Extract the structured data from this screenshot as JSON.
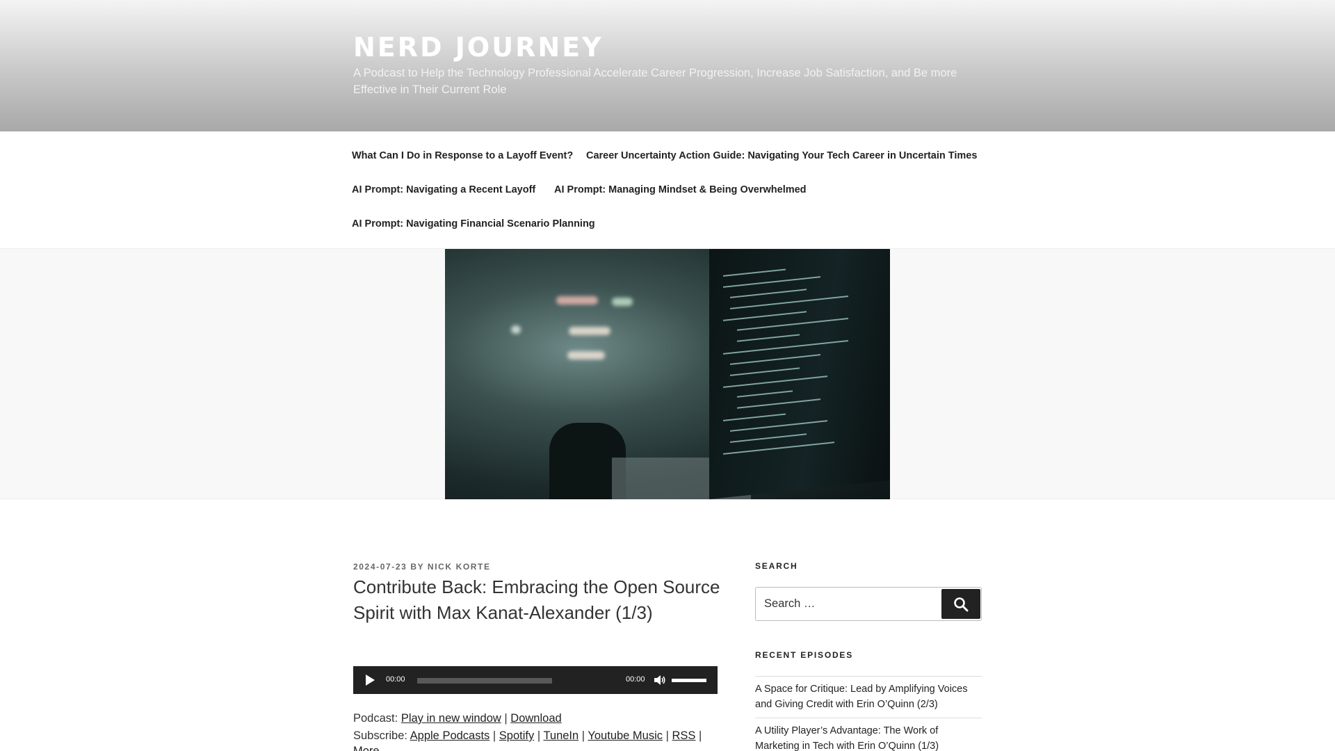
{
  "site": {
    "title": "NERD JOURNEY",
    "description": "A Podcast to Help the Technology Professional Accelerate Career Progression, Increase Job Satisfaction, and Be more Effective in Their Current Role"
  },
  "nav": {
    "items": [
      {
        "label": "What Can I Do in Response to a Layoff Event?"
      },
      {
        "label": "Career Uncertainty Action Guide: Navigating Your Tech Career in Uncertain Times"
      },
      {
        "label": "AI Prompt: Navigating a Recent Layoff"
      },
      {
        "label": "AI Prompt: Managing Mindset & Being Overwhelmed"
      },
      {
        "label": "AI Prompt: Navigating Financial Scenario Planning"
      }
    ]
  },
  "post": {
    "date": "2024-07-23",
    "by": "BY",
    "author": "NICK KORTE",
    "title": "Contribute Back: Embracing the Open Source Spirit with Max Kanat-Alexander (1/3)"
  },
  "player": {
    "current_time": "00:00",
    "duration": "00:00",
    "progress": 0,
    "volume": 1.0
  },
  "podcast": {
    "podcast_label": "Podcast:",
    "play_new_window": "Play in new window",
    "download": "Download",
    "subscribe_label": "Subscribe:",
    "apple": "Apple Podcasts",
    "spotify": "Spotify",
    "tunein": "TuneIn",
    "youtube_music": "Youtube Music",
    "rss": "RSS",
    "more": "More",
    "sep": "|"
  },
  "sidebar": {
    "search_title": "SEARCH",
    "search_placeholder": "Search …",
    "search_button_label": "Search",
    "recent_title": "RECENT EPISODES",
    "recent": [
      {
        "label": "A Space for Critique: Lead by Amplifying Voices and Giving Credit with Erin O’Quinn (2/3)"
      },
      {
        "label": "A Utility Player’s Advantage: The Work of Marketing in Tech with Erin O’Quinn (1/3)"
      }
    ]
  }
}
